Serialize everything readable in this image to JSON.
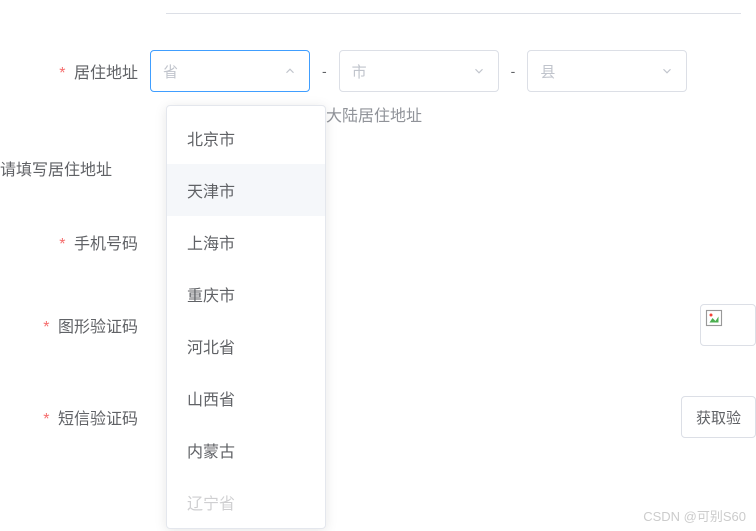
{
  "labels": {
    "address": "居住地址",
    "addressFull": "请填写居住地址",
    "phone": "手机号码",
    "captcha": "图形验证码",
    "sms": "短信验证码"
  },
  "selects": {
    "province": "省",
    "city": "市",
    "county": "县",
    "separator": "-"
  },
  "hint": "写大陆居住地址",
  "dropdown": {
    "items": [
      "北京市",
      "天津市",
      "上海市",
      "重庆市",
      "河北省",
      "山西省",
      "内蒙古",
      "辽宁省"
    ],
    "hoverIndex": 1
  },
  "smsButton": "获取验",
  "watermark": "CSDN @可别S60"
}
